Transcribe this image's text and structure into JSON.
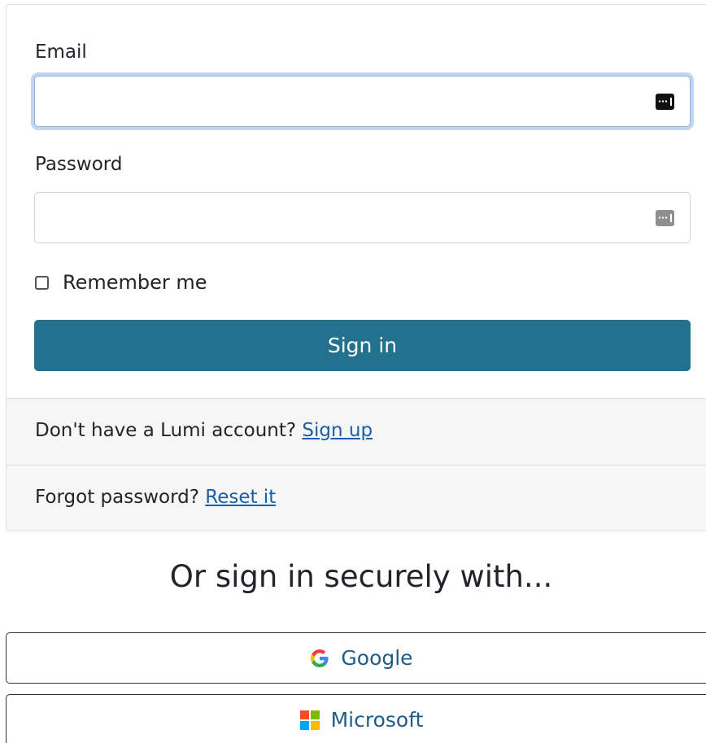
{
  "form": {
    "email_label": "Email",
    "email_value": "",
    "password_label": "Password",
    "password_value": "",
    "remember_label": "Remember me",
    "remember_checked": false,
    "signin_label": "Sign in"
  },
  "footer": {
    "signup_prompt": "Don't have a Lumi account?",
    "signup_link": "Sign up",
    "forgot_prompt": "Forgot password?",
    "reset_link": "Reset it"
  },
  "alt_signin": {
    "heading": "Or sign in securely with...",
    "providers": [
      {
        "label": "Google",
        "icon": "google-icon"
      },
      {
        "label": "Microsoft",
        "icon": "microsoft-icon"
      }
    ]
  },
  "colors": {
    "primary": "#22718f",
    "link": "#1b5fa6",
    "footer_bg": "#f6f6f6",
    "focus_ring": "#8ab4e6",
    "microsoft": [
      "#f25022",
      "#7fba00",
      "#00a4ef",
      "#ffb900"
    ],
    "google": [
      "#4285f4",
      "#ea4335",
      "#fbbc05",
      "#34a853"
    ]
  }
}
